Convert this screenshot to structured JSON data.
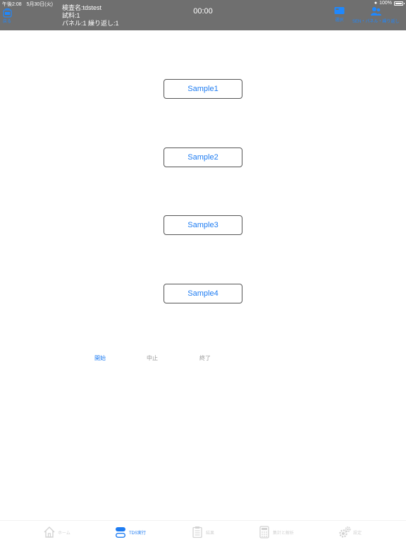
{
  "status_bar": {
    "time": "午後2:08　5月30日(火)",
    "battery": "100%"
  },
  "header": {
    "back_label": "戻る",
    "inspection_name": "検査名:tdstest",
    "sample": "試料:1",
    "panel": "パネル:1 繰り返し:1",
    "timer": "00:00",
    "mark_label": "選択",
    "sen_label": "SEN・パネル・繰り返し"
  },
  "samples": [
    {
      "label": "Sample1"
    },
    {
      "label": "Sample2"
    },
    {
      "label": "Sample3"
    },
    {
      "label": "Sample4"
    }
  ],
  "controls": {
    "start": "開始",
    "stop": "中止",
    "end": "終了"
  },
  "tabs": [
    {
      "label": "ホーム",
      "icon": "home-icon",
      "active": false
    },
    {
      "label": "TDS実行",
      "icon": "tds-icon",
      "active": true
    },
    {
      "label": "結果",
      "icon": "clipboard-icon",
      "active": false
    },
    {
      "label": "集計と解析",
      "icon": "calculator-icon",
      "active": false
    },
    {
      "label": "設定",
      "icon": "gear-icon",
      "active": false
    }
  ],
  "colors": {
    "accent": "#1e7cf2",
    "header_bg": "#6f6f6f",
    "inactive": "#d2d2d2"
  }
}
